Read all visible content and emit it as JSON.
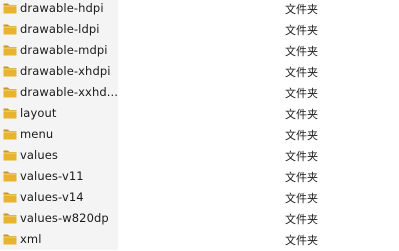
{
  "files": [
    {
      "name": "drawable-hdpi",
      "type": "文件夹",
      "icon": "folder-icon"
    },
    {
      "name": "drawable-ldpi",
      "type": "文件夹",
      "icon": "folder-icon"
    },
    {
      "name": "drawable-mdpi",
      "type": "文件夹",
      "icon": "folder-icon"
    },
    {
      "name": "drawable-xhdpi",
      "type": "文件夹",
      "icon": "folder-icon"
    },
    {
      "name": "drawable-xxhd...",
      "type": "文件夹",
      "icon": "folder-icon"
    },
    {
      "name": "layout",
      "type": "文件夹",
      "icon": "folder-icon"
    },
    {
      "name": "menu",
      "type": "文件夹",
      "icon": "folder-icon"
    },
    {
      "name": "values",
      "type": "文件夹",
      "icon": "folder-icon"
    },
    {
      "name": "values-v11",
      "type": "文件夹",
      "icon": "folder-icon"
    },
    {
      "name": "values-v14",
      "type": "文件夹",
      "icon": "folder-icon"
    },
    {
      "name": "values-w820dp",
      "type": "文件夹",
      "icon": "folder-icon"
    },
    {
      "name": "xml",
      "type": "文件夹",
      "icon": "folder-icon"
    }
  ],
  "colors": {
    "folder_front": "#e8b430",
    "folder_back": "#c99624",
    "name_column_bg": "#f4f4f4"
  }
}
